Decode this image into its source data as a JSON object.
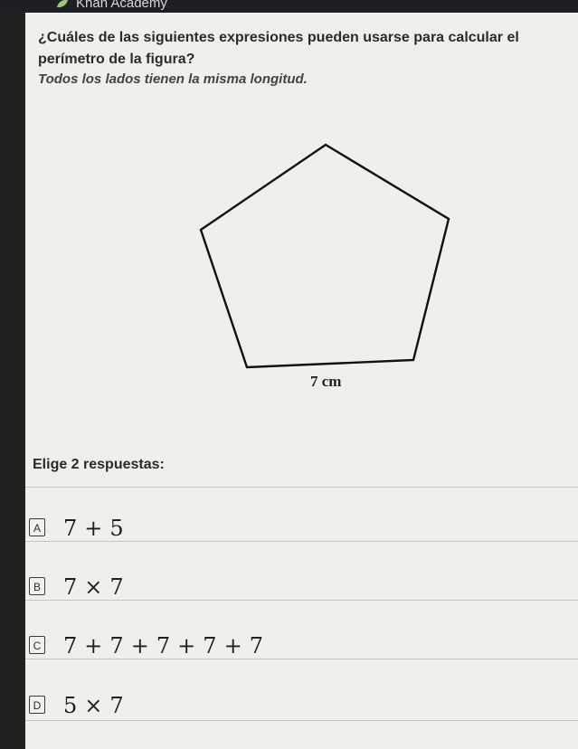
{
  "header": {
    "brand": "Khan Academy"
  },
  "question": {
    "text": "¿Cuáles de las siguientes expresiones pueden usarse para calcular el perímetro de la figura?",
    "hint": "Todos los lados tienen la misma longitud."
  },
  "figure": {
    "shape": "pentagon",
    "side_label": "7 cm"
  },
  "answers": {
    "title": "Elige 2 respuestas:",
    "options": [
      {
        "letter": "A",
        "expression": "7 + 5"
      },
      {
        "letter": "B",
        "expression": "7 × 7"
      },
      {
        "letter": "C",
        "expression": "7 + 7 + 7 + 7 + 7"
      },
      {
        "letter": "D",
        "expression": "5 × 7"
      }
    ]
  },
  "colors": {
    "background": "#efefec",
    "topbar": "#1e1e24",
    "text": "#2b2b2b"
  },
  "icons": {
    "brand": "khan-academy-leaf-icon",
    "figure": "pentagon-shape"
  }
}
